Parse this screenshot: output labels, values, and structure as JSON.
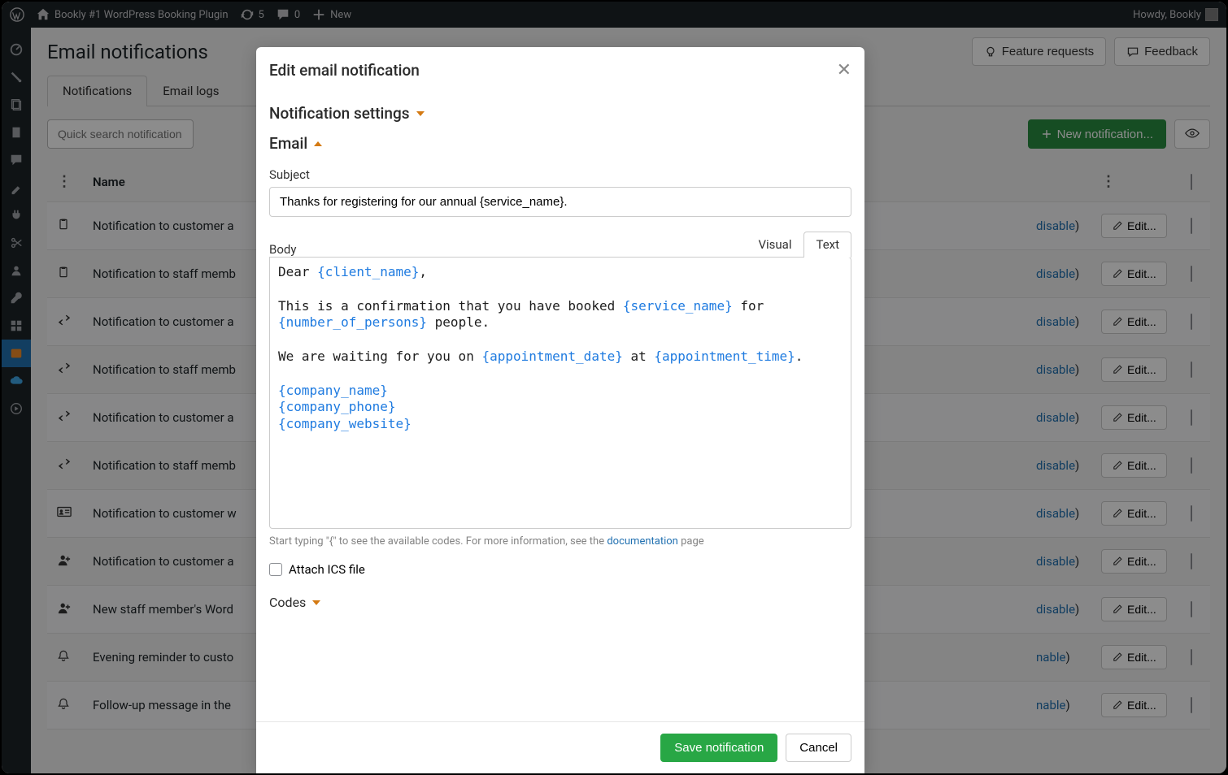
{
  "wp_bar": {
    "site_title": "Bookly #1 WordPress Booking Plugin",
    "updates": "5",
    "comments": "0",
    "new": "New",
    "howdy": "Howdy, Bookly"
  },
  "page": {
    "title": "Email notifications",
    "feature_btn": "Feature requests",
    "feedback_btn": "Feedback"
  },
  "tabs": {
    "notifications": "Notifications",
    "logs": "Email logs"
  },
  "toolbar": {
    "search_ph": "Quick search notification",
    "new_btn": "New notification..."
  },
  "table": {
    "name_header": "Name",
    "edit_label": "Edit...",
    "rows": [
      {
        "icon": "clipboard",
        "name": "Notification to customer a",
        "state": "disable"
      },
      {
        "icon": "clipboard",
        "name": "Notification to staff memb",
        "state": "disable"
      },
      {
        "icon": "hswap",
        "name": "Notification to customer a",
        "state": "disable"
      },
      {
        "icon": "hswap",
        "name": "Notification to staff memb",
        "state": "disable"
      },
      {
        "icon": "hswap",
        "name": "Notification to customer a",
        "state": "disable"
      },
      {
        "icon": "hswap",
        "name": "Notification to staff memb",
        "state": "disable"
      },
      {
        "icon": "idcard",
        "name": "Notification to customer w",
        "state": "disable"
      },
      {
        "icon": "userplus",
        "name": "Notification to customer a",
        "state": "disable"
      },
      {
        "icon": "userplus",
        "name": "New staff member's Word",
        "state": "disable"
      },
      {
        "icon": "bell",
        "name": "Evening reminder to custo",
        "state": "nable"
      },
      {
        "icon": "bell",
        "name": "Follow-up message in the",
        "state": "nable"
      }
    ]
  },
  "modal": {
    "title": "Edit email notification",
    "settings": "Notification settings",
    "email": "Email",
    "subject_label": "Subject",
    "subject_value": "Thanks for registering for our annual {service_name}.",
    "body_label": "Body",
    "tab_visual": "Visual",
    "tab_text": "Text",
    "body_segments": [
      {
        "t": "Dear ",
        "k": 0
      },
      {
        "t": "{client_name}",
        "k": 1
      },
      {
        "t": ",\n\nThis is a confirmation that you have booked ",
        "k": 0
      },
      {
        "t": "{service_name}",
        "k": 1
      },
      {
        "t": " for ",
        "k": 0
      },
      {
        "t": "{number_of_persons}",
        "k": 1
      },
      {
        "t": " people.\n\nWe are waiting for you on ",
        "k": 0
      },
      {
        "t": "{appointment_date}",
        "k": 1
      },
      {
        "t": " at ",
        "k": 0
      },
      {
        "t": "{appointment_time}",
        "k": 1
      },
      {
        "t": ".\n\n",
        "k": 0
      },
      {
        "t": "{company_name}",
        "k": 1
      },
      {
        "t": "\n",
        "k": 0
      },
      {
        "t": "{company_phone}",
        "k": 1
      },
      {
        "t": "\n",
        "k": 0
      },
      {
        "t": "{company_website}",
        "k": 1
      }
    ],
    "hint_pre": "Start typing \"{\" to see the available codes. For more information, see the ",
    "hint_link": "documentation",
    "hint_post": " page",
    "attach_ics": "Attach ICS file",
    "codes": "Codes",
    "save": "Save notification",
    "cancel": "Cancel"
  }
}
